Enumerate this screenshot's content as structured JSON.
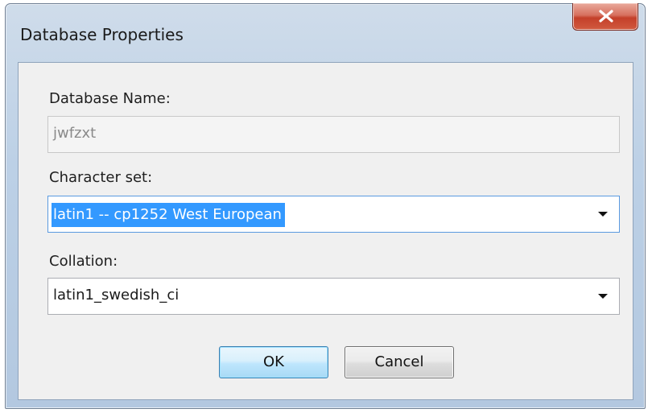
{
  "window": {
    "title": "Database Properties",
    "close_icon": "close-x-icon"
  },
  "form": {
    "database_name": {
      "label": "Database Name:",
      "value": "jwfzxt",
      "enabled": false
    },
    "character_set": {
      "label": "Character set:",
      "selected": "latin1 -- cp1252 West European"
    },
    "collation": {
      "label": "Collation:",
      "selected": "latin1_swedish_ci"
    }
  },
  "buttons": {
    "ok_label": "OK",
    "cancel_label": "Cancel"
  },
  "colors": {
    "selection_highlight": "#3399ff",
    "close_button": "#c4402a",
    "default_button_border": "#3c7fb1"
  }
}
